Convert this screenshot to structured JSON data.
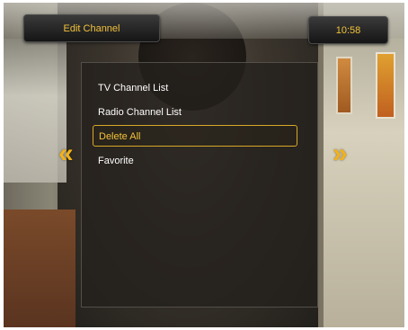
{
  "header": {
    "title": "Edit Channel",
    "time": "10:58"
  },
  "menu": {
    "items": [
      {
        "label": "TV Channel List",
        "selected": false
      },
      {
        "label": "Radio Channel List",
        "selected": false
      },
      {
        "label": "Delete All",
        "selected": true
      },
      {
        "label": "Favorite",
        "selected": false
      }
    ]
  },
  "nav": {
    "left_glyph": "«",
    "right_glyph": "»"
  },
  "colors": {
    "accent": "#f3c23a",
    "arrow": "#f2b21a",
    "text": "#ffffff"
  }
}
